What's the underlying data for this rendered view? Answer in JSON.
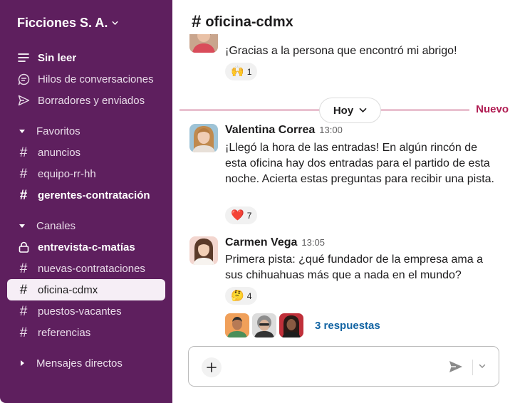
{
  "workspace": {
    "name": "Ficciones S. A."
  },
  "sidebar": {
    "top_items": [
      {
        "label": "Sin leer",
        "icon": "unread-icon"
      },
      {
        "label": "Hilos de conversaciones",
        "icon": "threads-icon"
      },
      {
        "label": "Borradores y enviados",
        "icon": "send-icon"
      }
    ],
    "favorites": {
      "label": "Favoritos",
      "items": [
        {
          "label": "anuncios"
        },
        {
          "label": "equipo-rr-hh"
        },
        {
          "label": "gerentes-contratación"
        }
      ]
    },
    "channels": {
      "label": "Canales",
      "items": [
        {
          "label": "entrevista-c-matías",
          "icon": "lock-icon"
        },
        {
          "label": "nuevas-contrataciones"
        },
        {
          "label": "oficina-cdmx"
        },
        {
          "label": "puestos-vacantes"
        },
        {
          "label": "referencias"
        }
      ]
    },
    "direct_messages": {
      "label": "Mensajes directos"
    }
  },
  "channel": {
    "hash": "#",
    "name": "oficina-cdmx"
  },
  "messages": [
    {
      "text": "¡Gracias a la persona que encontró mi abrigo!",
      "reaction": {
        "emoji": "🙌",
        "count": "1"
      }
    },
    {
      "sender": "Valentina Correa",
      "time": "13:00",
      "text": "¡Llegó la hora de las entradas! En algún rincón de esta oficina hay dos entradas para el partido de esta noche. Acierta estas preguntas para recibir una pista.",
      "reaction": {
        "emoji": "❤️",
        "count": "7"
      }
    },
    {
      "sender": "Carmen Vega",
      "time": "13:05",
      "text": "Primera pista: ¿qué fundador de la empresa ama a sus chihuahuas más que a nada en el mundo?",
      "reaction": {
        "emoji": "🤔",
        "count": "4"
      },
      "thread": {
        "replies": "3 respuestas"
      }
    }
  ],
  "divider": {
    "day": "Hoy",
    "new_label": "Nuevo"
  },
  "colors": {
    "sidebar_bg": "#5e1f5e",
    "active_item_bg": "#f6eef6",
    "new_accent": "#b01c52",
    "link": "#1264a3"
  }
}
